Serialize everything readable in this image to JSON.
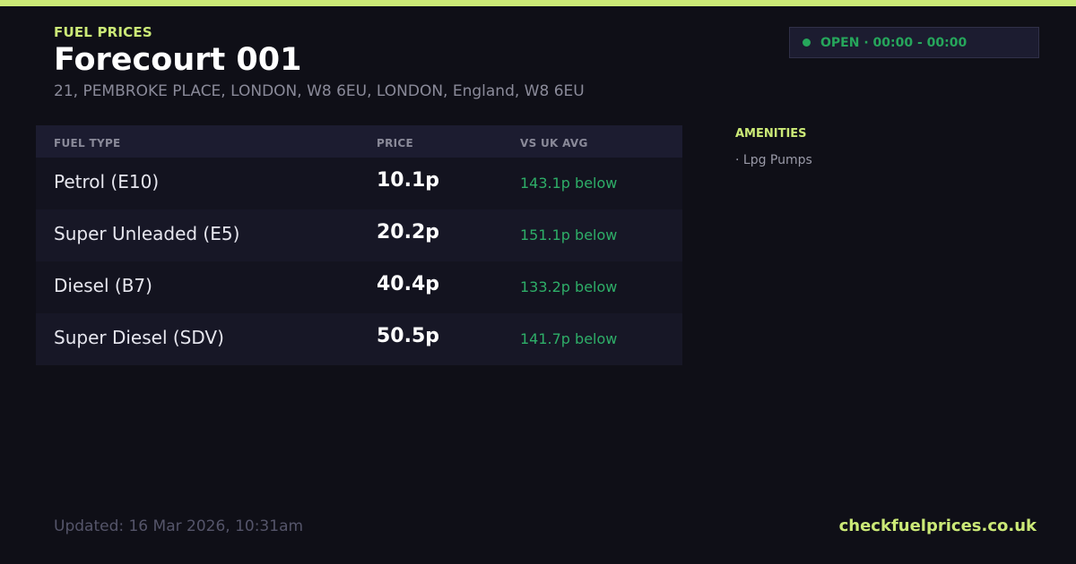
{
  "header": {
    "eyebrow": "FUEL PRICES",
    "title": "Forecourt 001",
    "address": "21, PEMBROKE PLACE, LONDON, W8 6EU, LONDON, England, W8 6EU"
  },
  "status": {
    "text": "OPEN · 00:00 - 00:00",
    "color": "#26a65b"
  },
  "table": {
    "headers": {
      "fuel_type": "FUEL TYPE",
      "price": "PRICE",
      "vs_avg": "VS UK AVG"
    },
    "rows": [
      {
        "name": "Petrol (E10)",
        "price": "10.1p",
        "diff": "143.1p below"
      },
      {
        "name": "Super Unleaded (E5)",
        "price": "20.2p",
        "diff": "151.1p below"
      },
      {
        "name": "Diesel (B7)",
        "price": "40.4p",
        "diff": "133.2p below"
      },
      {
        "name": "Super Diesel (SDV)",
        "price": "50.5p",
        "diff": "141.7p below"
      }
    ]
  },
  "amenities": {
    "title": "AMENITIES",
    "items": [
      "· Lpg Pumps"
    ]
  },
  "footer": {
    "updated": "Updated: 16 Mar 2026, 10:31am",
    "site": "checkfuelprices.co.uk"
  },
  "colors": {
    "accent": "#cbe977",
    "background": "#0f0f17",
    "positive": "#2eae68"
  }
}
